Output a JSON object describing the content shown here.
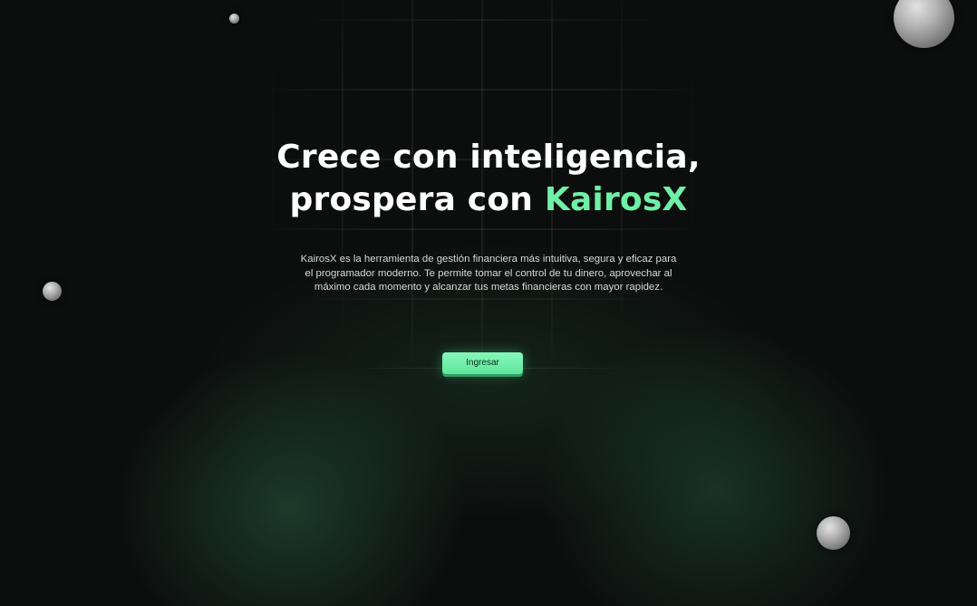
{
  "hero": {
    "title_line1": "Crece con inteligencia,",
    "title_line2_prefix": "prospera con ",
    "title_brand": "KairosX",
    "description_line1": "KairosX es la herramienta de gestión financiera más intuitiva, segura y eficaz para",
    "description_line2": "el programador moderno. Te permite tomar el control de tu dinero, aprovechar al",
    "description_line3": "máximo cada momento y alcanzar tus metas financieras con mayor rapidez.",
    "cta_label": "Ingresar"
  },
  "colors": {
    "background": "#0c0d0d",
    "accent": "#6ef0a6",
    "button": "#6cefa6",
    "glow": "#285f42"
  }
}
